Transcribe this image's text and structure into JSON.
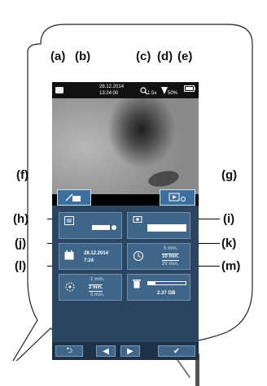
{
  "labels": {
    "a": "(a)",
    "b": "(b)",
    "c": "(c)",
    "d": "(d)",
    "e": "(e)",
    "f": "(f)",
    "g": "(g)",
    "h": "(h)",
    "i": "(i)",
    "j": "(j)",
    "k": "(k)",
    "l": "(l)",
    "m": "(m)"
  },
  "statusbar": {
    "date": "28.12.2014",
    "time": "13:24:00",
    "zoom": "1.5x",
    "brightness": "50%"
  },
  "settings": {
    "date_value": "28.12.2014",
    "time_value": "7:24",
    "timer_options": [
      "5 min.",
      "10 min.",
      "20 min."
    ],
    "timer_selected": "10 min.",
    "standby_options": [
      "1 min.",
      "2 min.",
      "5 min."
    ],
    "standby_selected": "2 min.",
    "storage_free": "2.37 GB"
  },
  "icons": {
    "camera": "camera-icon",
    "zoom": "magnifier-icon",
    "brightness": "lamp-icon",
    "battery": "battery-icon",
    "photo_video": "photo-video-toggle-icon",
    "gallery": "gallery-play-icon",
    "contrast": "contrast-icon",
    "display_brightness": "display-brightness-icon",
    "calendar": "calendar-icon",
    "timer": "timer-icon",
    "standby": "standby-icon",
    "trash": "trash-icon",
    "back": "back-arrow-icon",
    "left": "left-arrow-icon",
    "right": "right-arrow-icon",
    "confirm": "check-icon"
  },
  "colors": {
    "menu_bg": "#2b4560",
    "tile_bg": "#3f6588",
    "softkey": "#3a6fa0",
    "statusbar": "#111111"
  }
}
